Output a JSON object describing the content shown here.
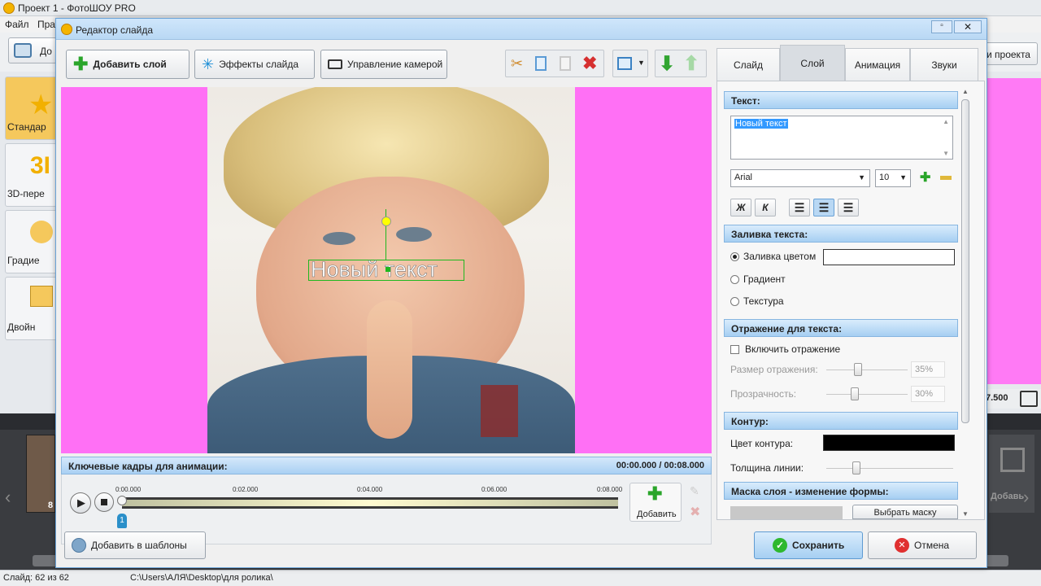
{
  "app": {
    "title": "Проект 1 - ФотоШОУ PRO",
    "menu": [
      "Файл",
      "Пра"
    ],
    "toolbar_left_label": "До",
    "toolbar_right_label": "и проекта",
    "left_items": [
      "Стандар",
      "3D-пере",
      "Градие",
      "Двойн"
    ],
    "left_3d_text": "3I",
    "right_time": "7.500",
    "timeline_slide_num": "8",
    "timeline_add_label": "Добавь"
  },
  "status": {
    "slide": "Слайд: 62 из 62",
    "path": "C:\\Users\\АЛЯ\\Desktop\\для ролика\\"
  },
  "dialog": {
    "title": "Редактор слайда",
    "toolbar": {
      "add_layer": "Добавить слой",
      "slide_effects": "Эффекты слайда",
      "camera": "Управление камерой"
    },
    "canvas_text": "Новый текст",
    "keyframes": {
      "title": "Ключевые кадры для анимации:",
      "time": "00:00.000 / 00:08.000",
      "ticks": [
        "0:00.000",
        "0:02.000",
        "0:04.000",
        "0:06.000",
        "0:08.000"
      ],
      "marker": "1",
      "add_label": "Добавить"
    },
    "tabs": [
      "Слайд",
      "Слой",
      "Анимация",
      "Звуки"
    ],
    "props": {
      "text_section": "Текст:",
      "text_value": "Новый текст",
      "font": "Arial",
      "size": "10",
      "bold": "Ж",
      "italic": "К",
      "fill_section": "Заливка текста:",
      "fill_color": "Заливка цветом",
      "fill_gradient": "Градиент",
      "fill_texture": "Текстура",
      "reflection_section": "Отражение для текста:",
      "reflection_enable": "Включить отражение",
      "reflection_size": "Размер отражения:",
      "reflection_size_value": "35%",
      "transparency": "Прозрачность:",
      "transparency_value": "30%",
      "outline_section": "Контур:",
      "outline_color": "Цвет контура:",
      "line_width": "Толщина линии:",
      "mask_section": "Маска слоя - изменение формы:",
      "mask_button": "Выбрать маску"
    },
    "bottom": {
      "add_template": "Добавить в шаблоны",
      "save": "Сохранить",
      "cancel": "Отмена"
    }
  },
  "colors": {
    "stage_bg": "#ff70f5",
    "accent": "#a6cff2",
    "outline_color": "#000000",
    "fill_color": "#ffffff"
  }
}
